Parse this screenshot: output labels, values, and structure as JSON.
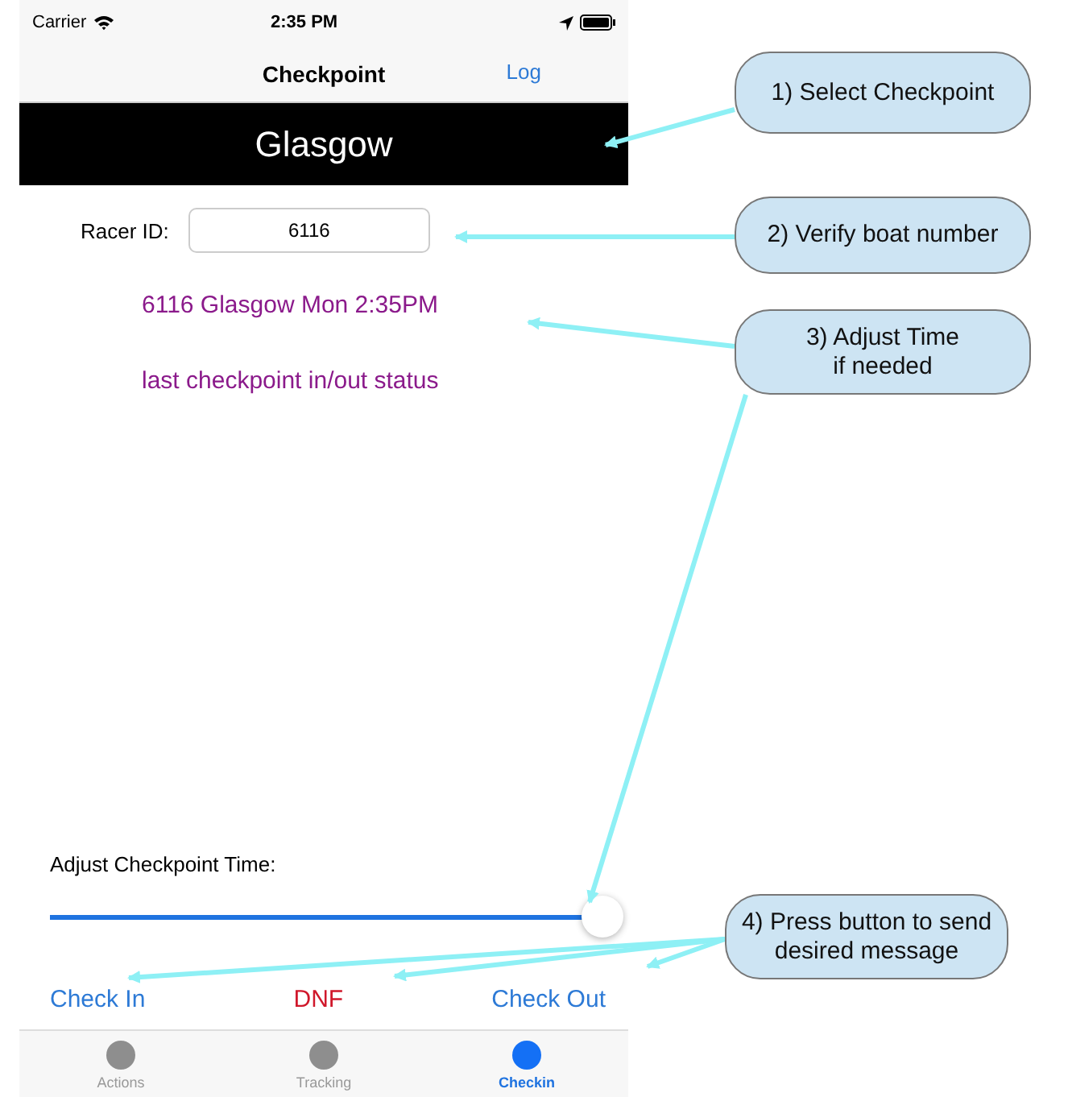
{
  "status_bar": {
    "carrier": "Carrier",
    "time": "2:35 PM"
  },
  "nav_bar": {
    "title": "Checkpoint",
    "action": "Log"
  },
  "checkpoint_picker": {
    "value": "Glasgow"
  },
  "racer_id": {
    "label": "Racer ID:",
    "value": "6116"
  },
  "messages": [
    "6116 Glasgow Mon 2:35PM",
    "last checkpoint in/out status"
  ],
  "time_slider": {
    "label": "Adjust Checkpoint Time:",
    "level": 1.0
  },
  "buttons": [
    {
      "label": "Check In",
      "kind": "normal"
    },
    {
      "label": "DNF",
      "kind": "destructive"
    },
    {
      "label": "Check Out",
      "kind": "normal"
    }
  ],
  "tab_bar": [
    {
      "label": "Actions",
      "selected": false
    },
    {
      "label": "Tracking",
      "selected": false
    },
    {
      "label": "Checkin",
      "selected": true
    }
  ],
  "callouts": [
    "1) Select Checkpoint",
    "2) Verify boat number",
    "3) Adjust Time\nif needed",
    "4) Press button to send\ndesired message"
  ]
}
